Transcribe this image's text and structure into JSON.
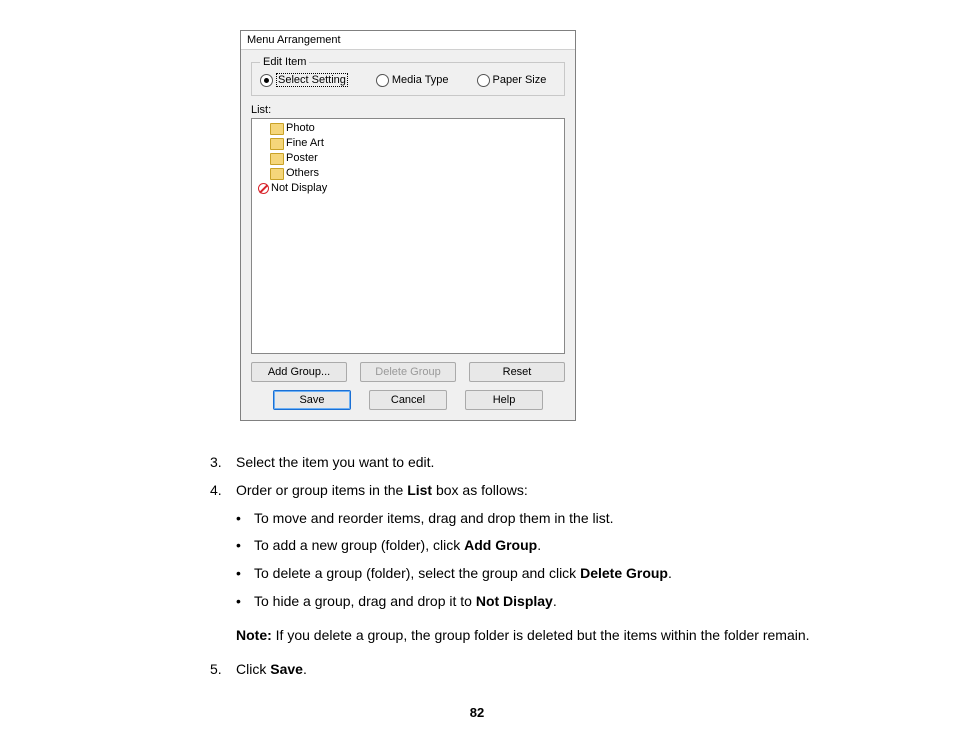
{
  "dialog": {
    "title": "Menu Arrangement",
    "group_legend": "Edit Item",
    "radios": {
      "select_setting": "Select Setting",
      "media_type": "Media Type",
      "paper_size": "Paper Size"
    },
    "list_label": "List:",
    "tree": {
      "photo": "Photo",
      "fine_art": "Fine Art",
      "poster": "Poster",
      "others": "Others",
      "not_display": "Not Display"
    },
    "buttons": {
      "add_group": "Add Group...",
      "delete_group": "Delete Group",
      "reset": "Reset",
      "save": "Save",
      "cancel": "Cancel",
      "help": "Help"
    }
  },
  "instructions": {
    "step3_num": "3.",
    "step3_text": "Select the item you want to edit.",
    "step4_num": "4.",
    "step4_prefix": "Order or group items in the ",
    "step4_bold": "List",
    "step4_suffix": " box as follows:",
    "bullet1": "To move and reorder items, drag and drop them in the list.",
    "bullet2_prefix": "To add a new group (folder), click ",
    "bullet2_bold": "Add Group",
    "bullet2_suffix": ".",
    "bullet3_prefix": "To delete a group (folder), select the group and click ",
    "bullet3_bold": "Delete Group",
    "bullet3_suffix": ".",
    "bullet4_prefix": "To hide a group, drag and drop it to ",
    "bullet4_bold": "Not Display",
    "bullet4_suffix": ".",
    "note_label": "Note:",
    "note_text": " If you delete a group, the group folder is deleted but the items within the folder remain.",
    "step5_num": "5.",
    "step5_prefix": "Click ",
    "step5_bold": "Save",
    "step5_suffix": "."
  },
  "page_number": "82",
  "bullet_char": "•"
}
